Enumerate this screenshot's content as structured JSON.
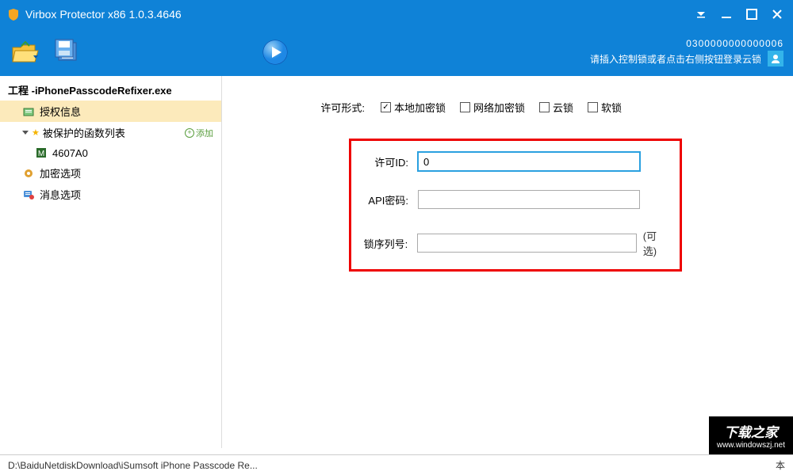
{
  "titlebar": {
    "title": "Virbox Protector x86  1.0.3.4646"
  },
  "toolbar": {
    "serial": "0300000000000006",
    "hint": "请插入控制锁或者点击右侧按钮登录云锁"
  },
  "sidebar": {
    "project": "工程 -iPhonePasscodeRefixer.exe",
    "license_info": "授权信息",
    "protected_funcs": "被保护的函数列表",
    "add": "添加",
    "func1": "4607A0",
    "encrypt_opts": "加密选项",
    "message_opts": "消息选项"
  },
  "main": {
    "license_type_label": "许可形式:",
    "cb_local": "本地加密锁",
    "cb_network": "网络加密锁",
    "cb_cloud": "云锁",
    "cb_soft": "软锁",
    "license_id_label": "许可ID:",
    "license_id_value": "0",
    "api_pwd_label": "API密码:",
    "api_pwd_value": "",
    "lock_serial_label": "锁序列号:",
    "lock_serial_value": "",
    "optional": "(可选)"
  },
  "status": {
    "path": "D:\\BaiduNetdiskDownload\\iSumsoft iPhone Passcode Re...",
    "right": "本"
  },
  "watermark": {
    "big": "下载之家",
    "url": "www.windowszj.net"
  }
}
